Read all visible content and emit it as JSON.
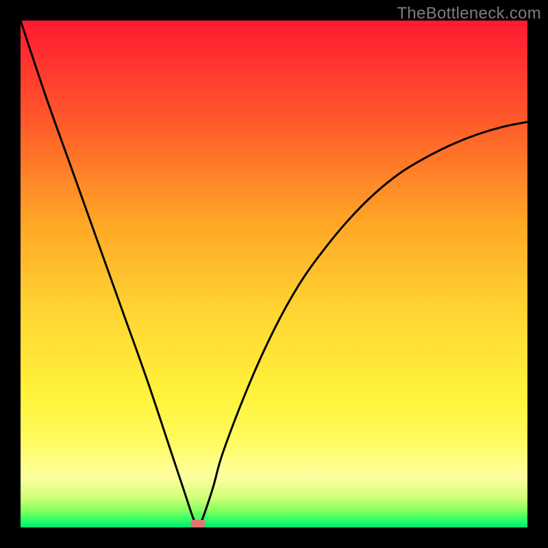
{
  "watermark": "TheBottleneck.com",
  "chart_data": {
    "type": "line",
    "title": "",
    "xlabel": "",
    "ylabel": "",
    "xlim": [
      0,
      100
    ],
    "ylim": [
      0,
      100
    ],
    "x": [
      0,
      5,
      10,
      15,
      20,
      25,
      30,
      32,
      34,
      35,
      36,
      38,
      40,
      45,
      50,
      55,
      60,
      65,
      70,
      75,
      80,
      85,
      90,
      95,
      100
    ],
    "y": [
      100,
      85,
      71,
      57,
      43,
      29,
      14,
      8,
      2,
      0,
      2,
      8,
      15,
      28,
      39,
      48,
      55,
      61,
      66,
      70,
      73,
      75.5,
      77.5,
      79,
      80
    ],
    "optimum_marker_x": 35,
    "optimum_marker_width": 3,
    "gradient_stops": [
      {
        "offset": 0.0,
        "color": "#ff1a33"
      },
      {
        "offset": 0.2,
        "color": "#ff5a2a"
      },
      {
        "offset": 0.4,
        "color": "#ffa726"
      },
      {
        "offset": 0.58,
        "color": "#ffd633"
      },
      {
        "offset": 0.74,
        "color": "#fff33a"
      },
      {
        "offset": 0.83,
        "color": "#fffb60"
      },
      {
        "offset": 0.9,
        "color": "#fdffa0"
      },
      {
        "offset": 0.94,
        "color": "#d3ff7a"
      },
      {
        "offset": 0.965,
        "color": "#8bff60"
      },
      {
        "offset": 0.985,
        "color": "#2eff66"
      },
      {
        "offset": 1.0,
        "color": "#00e676"
      }
    ],
    "curve_color": "#000000",
    "marker_color": "#e57373"
  }
}
